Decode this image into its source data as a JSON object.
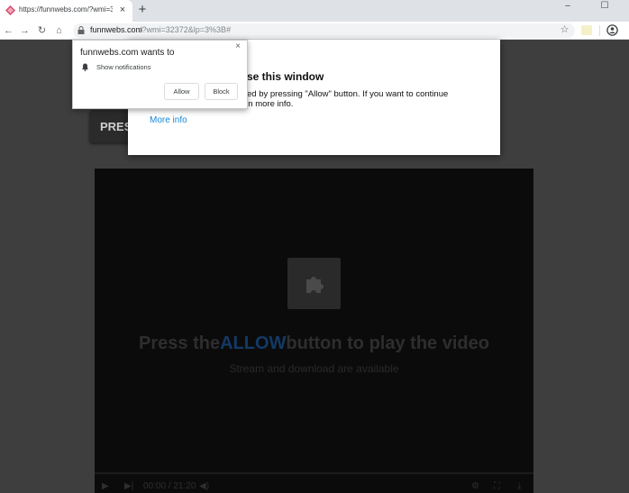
{
  "browser": {
    "tab_title": "https://funnwebs.com/?wmi=323",
    "tab_close": "×",
    "new_tab": "+",
    "window_minimize": "–",
    "window_maximize": "☐",
    "url_host": "funnwebs.com",
    "url_rest": "/?wmi=32372&lp=3%3B#"
  },
  "page": {
    "press_button_fragment": "PRES",
    "video": {
      "headline_prefix": "Press the",
      "headline_highlight": "ALLOW",
      "headline_suffix": "button to play the video",
      "subtitle": "Stream and download are available",
      "time": "00:00 / 21:20"
    }
  },
  "dialog": {
    "title_fragment": "se this window",
    "line1_fragment": "ed by pressing \"Allow\" button. If you want to continue",
    "line2_fragment": "on more info.",
    "more_info": "More info"
  },
  "permission_prompt": {
    "title": "funnwebs.com wants to",
    "permission": "Show notifications",
    "allow_label": "Allow",
    "block_label": "Block",
    "close": "×"
  },
  "colors": {
    "page_background": "#3e3e3e",
    "video_background": "#0b0b0b",
    "allow_highlight": "#133a66",
    "link_blue": "#1a86d9"
  },
  "icons": [
    "tab-favicon-icon",
    "back-arrow-icon",
    "forward-arrow-icon",
    "reload-icon",
    "home-icon",
    "lock-icon",
    "star-icon",
    "extension-icon",
    "account-icon",
    "puzzle-plugin-icon",
    "bell-icon",
    "play-icon",
    "next-icon",
    "volume-icon",
    "gear-icon",
    "fullscreen-icon",
    "download-icon"
  ]
}
